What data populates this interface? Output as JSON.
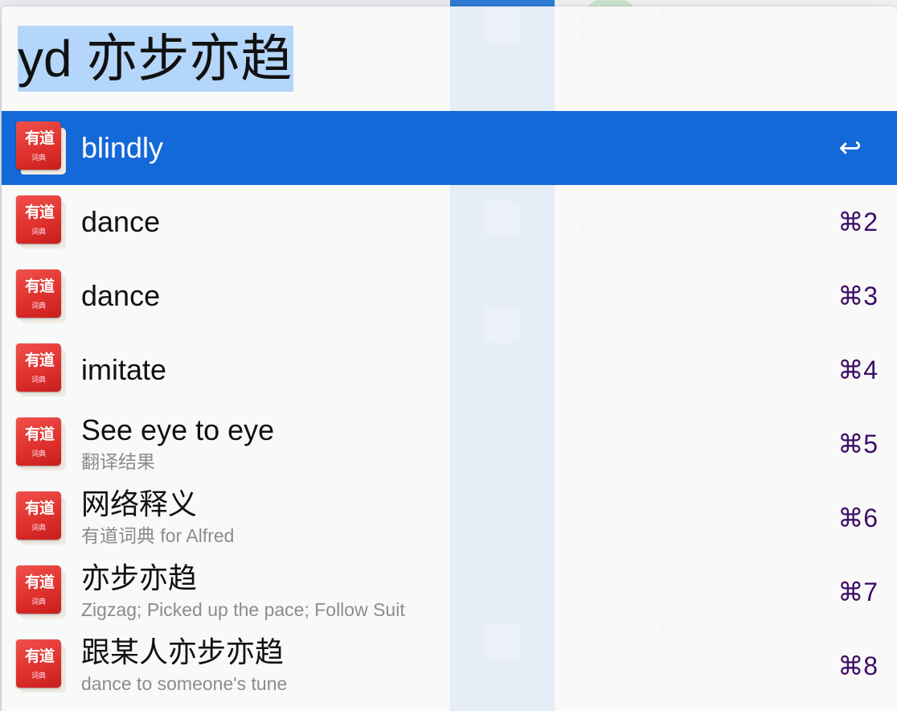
{
  "search": {
    "query": "yd 亦步亦趋"
  },
  "results": [
    {
      "title": "blindly",
      "subtitle": "",
      "shortcut": "↩",
      "selected": true
    },
    {
      "title": "dance",
      "subtitle": "",
      "shortcut": "⌘2",
      "selected": false
    },
    {
      "title": "dance",
      "subtitle": "",
      "shortcut": "⌘3",
      "selected": false
    },
    {
      "title": "imitate",
      "subtitle": "",
      "shortcut": "⌘4",
      "selected": false
    },
    {
      "title": "See eye to eye",
      "subtitle": "翻译结果",
      "shortcut": "⌘5",
      "selected": false
    },
    {
      "title": "网络释义",
      "subtitle": "有道词典 for Alfred",
      "shortcut": "⌘6",
      "selected": false
    },
    {
      "title": "亦步亦趋",
      "subtitle": "Zigzag; Picked up the pace; Follow Suit",
      "shortcut": "⌘7",
      "selected": false
    },
    {
      "title": "跟某人亦步亦趋",
      "subtitle": "dance to someone's tune",
      "shortcut": "⌘8",
      "selected": false
    }
  ],
  "icons": {
    "result_icon": "youdao-dictionary-icon",
    "return_icon": "return-key-icon"
  },
  "colors": {
    "selection": "#1469d8",
    "query_highlight": "#b4d6fa",
    "shortcut": "#3d0e66",
    "subtitle": "#8c8c8c"
  }
}
